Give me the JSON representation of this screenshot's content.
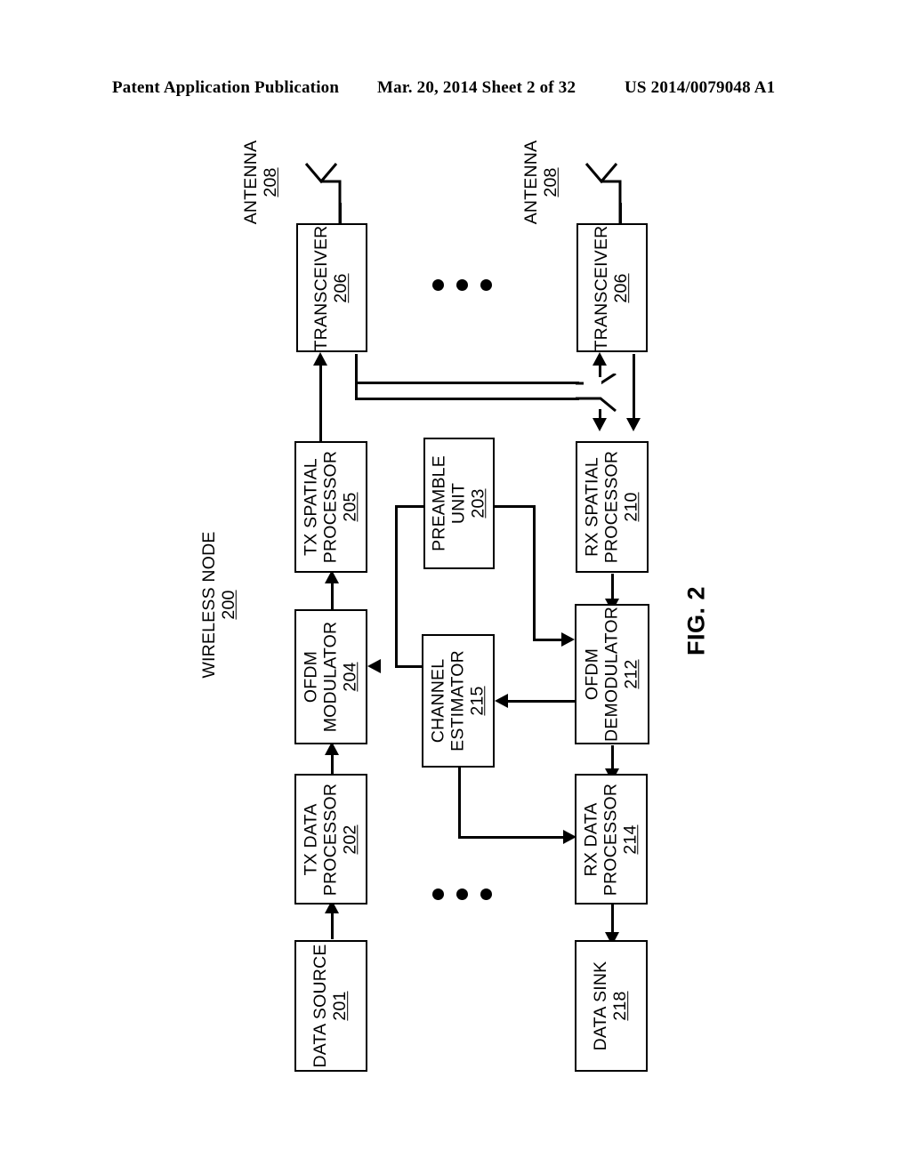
{
  "header": {
    "left": "Patent Application Publication",
    "middle": "Mar. 20, 2014  Sheet 2 of 32",
    "right": "US 2014/0079048 A1"
  },
  "figure": {
    "caption": "FIG. 2",
    "node_label": "WIRELESS NODE",
    "node_num": "200",
    "antenna_label": "ANTENNA",
    "antenna_num": "208",
    "ellipsis": "• • •"
  },
  "blocks": {
    "transceiver_1": {
      "label": "TRANSCEIVER",
      "num": "206"
    },
    "transceiver_2": {
      "label": "TRANSCEIVER",
      "num": "206"
    },
    "tx_spatial_processor": {
      "label": "TX SPATIAL\nPROCESSOR",
      "line1": "TX SPATIAL",
      "line2": "PROCESSOR",
      "num": "205"
    },
    "preamble_unit": {
      "line1": "PREAMBLE",
      "line2": "UNIT",
      "num": "203"
    },
    "rx_spatial_processor": {
      "line1": "RX SPATIAL",
      "line2": "PROCESSOR",
      "num": "210"
    },
    "ofdm_modulator": {
      "line1": "OFDM",
      "line2": "MODULATOR",
      "num": "204"
    },
    "channel_estimator": {
      "line1": "CHANNEL",
      "line2": "ESTIMATOR",
      "num": "215"
    },
    "ofdm_demodulator": {
      "line1": "OFDM",
      "line2": "DEMODULATOR",
      "num": "212"
    },
    "tx_data_processor": {
      "line1": "TX DATA",
      "line2": "PROCESSOR",
      "num": "202"
    },
    "rx_data_processor": {
      "line1": "RX DATA",
      "line2": "PROCESSOR",
      "num": "214"
    },
    "data_source": {
      "line1": "DATA SOURCE",
      "num": "201"
    },
    "data_sink": {
      "line1": "DATA SINK",
      "num": "218"
    }
  }
}
